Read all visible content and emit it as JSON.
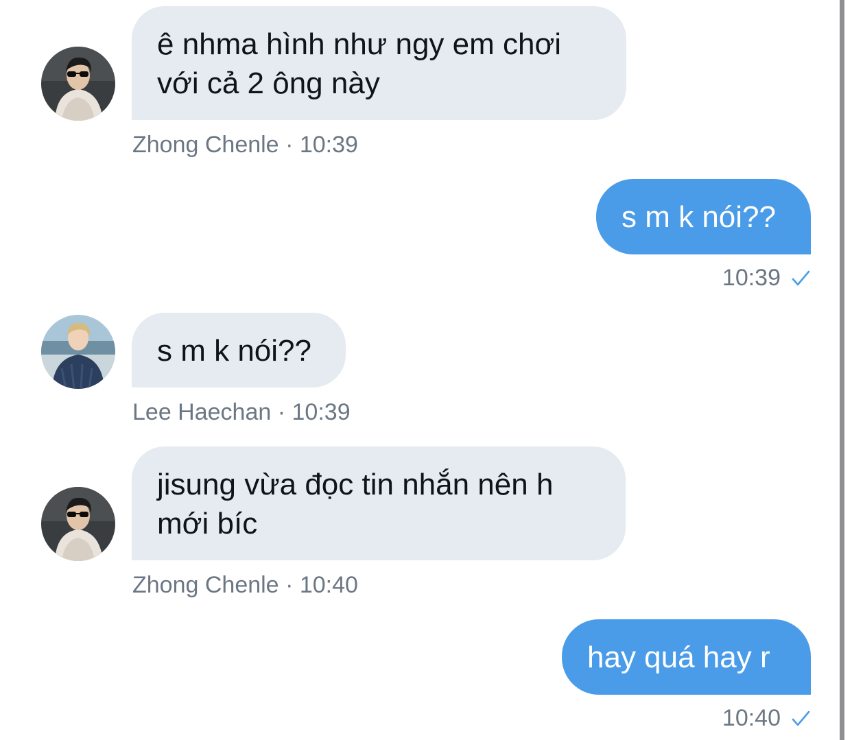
{
  "colors": {
    "incoming_bubble": "#e6eaf1",
    "outgoing_bubble": "#4a9ce8",
    "meta_text": "#6c7784",
    "check": "#4a9ce8"
  },
  "messages": [
    {
      "direction": "incoming",
      "text_line1": "ê nhma hình như ngy em chơi",
      "text_line2": "với cả 2 ông này",
      "sender": "Zhong Chenle",
      "separator": "·",
      "time": "10:39",
      "avatar_icon": "avatar-zhong-chenle"
    },
    {
      "direction": "outgoing",
      "text": "s m k nói??",
      "time": "10:39",
      "status_icon": "check-icon"
    },
    {
      "direction": "incoming",
      "text": "s m k nói??",
      "sender": "Lee Haechan",
      "separator": "·",
      "time": "10:39",
      "avatar_icon": "avatar-lee-haechan"
    },
    {
      "direction": "incoming",
      "text_line1": "jisung vừa đọc tin nhắn nên h",
      "text_line2": "mới bíc",
      "sender": "Zhong Chenle",
      "separator": "·",
      "time": "10:40",
      "avatar_icon": "avatar-zhong-chenle"
    },
    {
      "direction": "outgoing",
      "text": "hay quá hay r",
      "time": "10:40",
      "status_icon": "check-icon"
    }
  ]
}
